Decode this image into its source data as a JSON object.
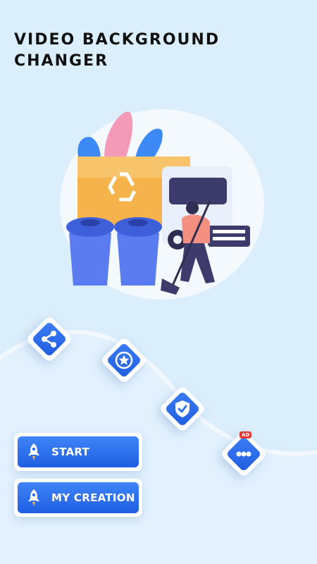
{
  "header": {
    "title_line1": "VIDEO BACKGROUND",
    "title_line2": "CHANGER"
  },
  "illustration": {
    "icon": "recycle-truck-illustration"
  },
  "nav_icons": [
    {
      "name": "share-icon"
    },
    {
      "name": "star-rate-icon"
    },
    {
      "name": "privacy-shield-icon"
    },
    {
      "name": "more-apps-icon",
      "badge": "AD"
    }
  ],
  "buttons": {
    "start_label": "START",
    "creation_label": "MY CREATION"
  },
  "colors": {
    "background": "#dbeefc",
    "accent": "#2a6ef0",
    "badge": "#e53935"
  }
}
